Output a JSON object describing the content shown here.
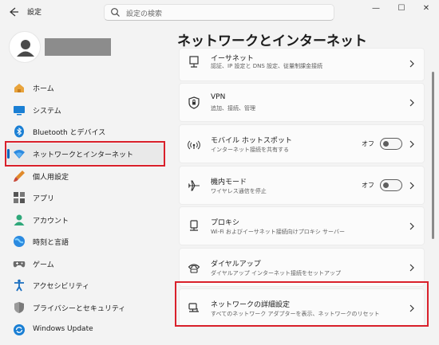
{
  "titlebar": {
    "back_icon": "back-arrow-icon",
    "app_title": "設定",
    "search_placeholder": "設定の検索",
    "minimize": "—",
    "maximize": "☐",
    "close": "✕"
  },
  "sidebar": {
    "items": [
      {
        "label": "ホーム",
        "icon": "home-icon"
      },
      {
        "label": "システム",
        "icon": "system-icon"
      },
      {
        "label": "Bluetooth とデバイス",
        "icon": "bluetooth-icon"
      },
      {
        "label": "ネットワークとインターネット",
        "icon": "wifi-icon",
        "active": true
      },
      {
        "label": "個人用設定",
        "icon": "brush-icon"
      },
      {
        "label": "アプリ",
        "icon": "apps-icon"
      },
      {
        "label": "アカウント",
        "icon": "account-icon"
      },
      {
        "label": "時刻と言語",
        "icon": "globe-icon"
      },
      {
        "label": "ゲーム",
        "icon": "gamepad-icon"
      },
      {
        "label": "アクセシビリティ",
        "icon": "accessibility-icon"
      },
      {
        "label": "プライバシーとセキュリティ",
        "icon": "shield-icon"
      },
      {
        "label": "Windows Update",
        "icon": "update-icon"
      }
    ]
  },
  "main": {
    "title": "ネットワークとインターネット",
    "cards": [
      {
        "title": "イーサネット",
        "subtitle": "認証、IP 設定と DNS 設定、従量制課金接続",
        "icon": "ethernet-icon"
      },
      {
        "title": "VPN",
        "subtitle": "追加、接続、管理",
        "icon": "vpn-shield-icon"
      },
      {
        "title": "モバイル ホットスポット",
        "subtitle": "インターネット接続を共有する",
        "icon": "hotspot-icon",
        "toggle": "オフ"
      },
      {
        "title": "機内モード",
        "subtitle": "ワイヤレス通信を停止",
        "icon": "airplane-icon",
        "toggle": "オフ"
      },
      {
        "title": "プロキシ",
        "subtitle": "Wi-Fi およびイーサネット接続向けプロキシ サーバー",
        "icon": "proxy-icon"
      },
      {
        "title": "ダイヤルアップ",
        "subtitle": "ダイヤルアップ インターネット接続をセットアップ",
        "icon": "dialup-icon"
      },
      {
        "title": "ネットワークの詳細設定",
        "subtitle": "すべてのネットワーク アダプターを表示、ネットワークのリセット",
        "icon": "network-pc-icon"
      }
    ]
  },
  "colors": {
    "accent": "#0067c0",
    "highlight": "#d9202b"
  }
}
